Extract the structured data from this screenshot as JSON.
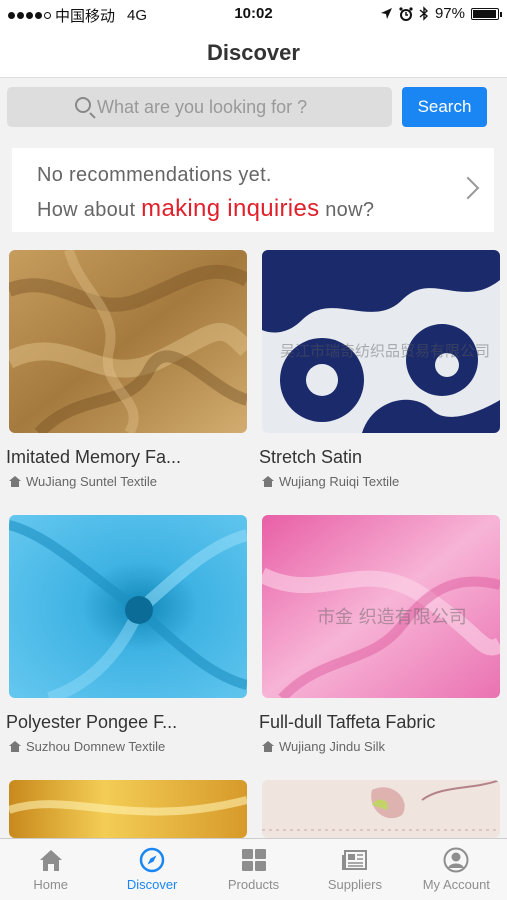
{
  "status_bar": {
    "carrier": "中国移动",
    "network": "4G",
    "time": "10:02",
    "battery": "97%",
    "battery_level": 0.97
  },
  "header": {
    "title": "Discover"
  },
  "search": {
    "placeholder": "What are you looking for ?",
    "button_label": "Search"
  },
  "recommendation": {
    "line1": "No recommendations yet.",
    "line2_prefix": "How about ",
    "line2_highlight": "making inquiries",
    "line2_suffix": " now?"
  },
  "products": [
    {
      "name": "Imitated Memory Fa...",
      "company": "WuJiang Suntel Textile",
      "watermark": ""
    },
    {
      "name": "Stretch Satin",
      "company": "Wujiang Ruiqi Textile",
      "watermark": "吴江市瑞奇纺织品贸易有限公司"
    },
    {
      "name": "Polyester Pongee F...",
      "company": "Suzhou Domnew Textile",
      "watermark": ""
    },
    {
      "name": "Full-dull Taffeta Fabric",
      "company": "Wujiang Jindu Silk",
      "watermark": "市金   织造有限公司"
    },
    {
      "name": "",
      "company": "",
      "watermark": ""
    },
    {
      "name": "",
      "company": "",
      "watermark": ""
    }
  ],
  "tabbar": {
    "items": [
      {
        "label": "Home",
        "icon": "home-icon",
        "active": false
      },
      {
        "label": "Discover",
        "icon": "compass-icon",
        "active": true
      },
      {
        "label": "Products",
        "icon": "grid-icon",
        "active": false
      },
      {
        "label": "Suppliers",
        "icon": "newspaper-icon",
        "active": false
      },
      {
        "label": "My Account",
        "icon": "person-icon",
        "active": false
      }
    ]
  },
  "colors": {
    "accent": "#1a86f3",
    "highlight": "#e0202a"
  }
}
